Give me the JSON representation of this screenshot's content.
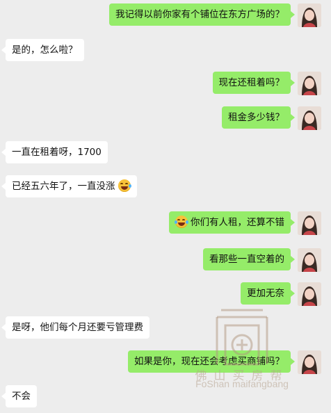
{
  "messages": [
    {
      "side": "right",
      "text": "我记得以前你家有个铺位在东方广场的？"
    },
    {
      "side": "left",
      "text": "是的，怎么啦？"
    },
    {
      "side": "right",
      "text": "现在还租着吗？"
    },
    {
      "side": "right",
      "text": "租金多少钱？"
    },
    {
      "side": "left",
      "text": "一直在租着呀，1700"
    },
    {
      "side": "left",
      "text": "已经五六年了，一直没涨",
      "emoji_after": "grinning-sweat-emoji"
    },
    {
      "side": "right",
      "text": "你们有人租，还算不错",
      "emoji_before": "laughing-tears-emoji"
    },
    {
      "side": "right",
      "text": "看那些一直空着的"
    },
    {
      "side": "right",
      "text": "更加无奈"
    },
    {
      "side": "left",
      "text": "是呀，他们每个月还要亏管理费"
    },
    {
      "side": "right",
      "text": "如果是你，现在还会考虑买商铺吗？"
    },
    {
      "side": "left",
      "text": "不会"
    }
  ],
  "watermark": {
    "chinese": "佛山买房帮",
    "english": "FoShan maifangbang"
  },
  "colors": {
    "background": "#ededed",
    "sent_bubble": "#95ec69",
    "received_bubble": "#ffffff"
  }
}
